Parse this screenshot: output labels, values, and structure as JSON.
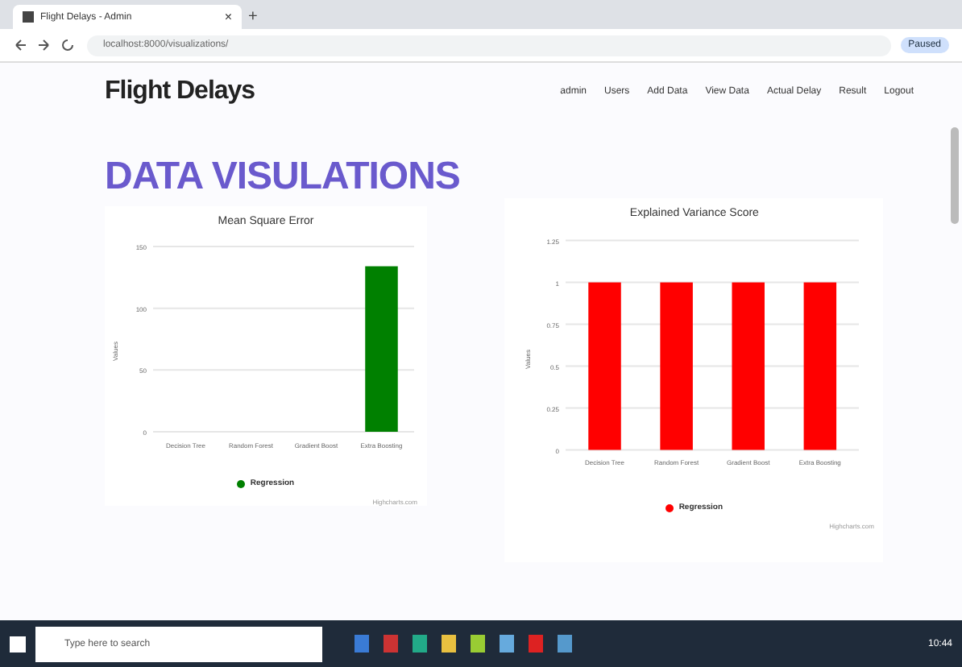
{
  "browser": {
    "tab_title": "Flight Delays - Admin",
    "tab_close": "×",
    "new_tab": "+",
    "address": "localhost:8000/visualizations/",
    "profile": "Paused"
  },
  "header": {
    "brand": "Flight Delays",
    "nav": [
      "admin",
      "Users",
      "Add Data",
      "View Data",
      "Actual Delay",
      "Result",
      "Logout"
    ]
  },
  "page_title": "DATA VISULATIONS",
  "charts": [
    {
      "chart_data": {
        "type": "bar",
        "title": "Mean Square Error",
        "ylabel": "Values",
        "categories": [
          "Decision Tree",
          "Random Forest",
          "Gradient Boost",
          "Extra Boosting"
        ],
        "series": [
          {
            "name": "Regression",
            "color": "#008000",
            "values": [
              0,
              0,
              0,
              134
            ]
          }
        ],
        "grid": true,
        "ylim": [
          0,
          150
        ],
        "yticks": [
          0,
          50,
          100,
          150
        ]
      },
      "credit": "Highcharts.com"
    },
    {
      "chart_data": {
        "type": "bar",
        "title": "Explained Variance Score",
        "ylabel": "Values",
        "categories": [
          "Decision Tree",
          "Random Forest",
          "Gradient Boost",
          "Extra Boosting"
        ],
        "series": [
          {
            "name": "Regression",
            "color": "#ff0000",
            "values": [
              1,
              1,
              1,
              1
            ]
          }
        ],
        "grid": true,
        "ylim": [
          0,
          1.25
        ],
        "yticks": [
          0,
          0.25,
          0.5,
          0.75,
          1,
          1.25
        ]
      },
      "credit": "Highcharts.com"
    }
  ],
  "taskbar": {
    "search_placeholder": "Type here to search",
    "time": "10:44"
  }
}
